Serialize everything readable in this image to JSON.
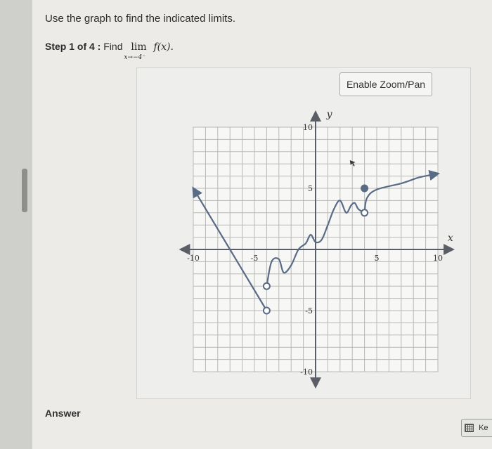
{
  "instruction": "Use the graph to find the indicated limits.",
  "step": {
    "label": "Step 1 of 4 :",
    "find": "Find",
    "lim": "lim",
    "sub": "x→−4⁻",
    "fx": "f(x)."
  },
  "zoom_button": "Enable Zoom/Pan",
  "answer_label": "Answer",
  "keypad_label": "Ke",
  "colors": {
    "curve": "#5a6b86",
    "grid": "#b8b8b4",
    "axis": "#5a5e66"
  },
  "graph": {
    "xlim": [
      -10,
      10
    ],
    "ylim": [
      -10,
      10
    ],
    "axis_labels": {
      "x": "x",
      "y": "y"
    },
    "x_ticks": [
      {
        "value": -10,
        "label": "-10"
      },
      {
        "value": -5,
        "label": "-5"
      },
      {
        "value": 5,
        "label": "5"
      },
      {
        "value": 10,
        "label": "10"
      }
    ],
    "y_ticks": [
      {
        "value": 10,
        "label": "10"
      },
      {
        "value": 5,
        "label": "5"
      },
      {
        "value": -5,
        "label": "-5"
      },
      {
        "value": -10,
        "label": "-10"
      }
    ],
    "segments": [
      {
        "type": "line",
        "points": [
          [
            -10,
            5
          ],
          [
            -4,
            -5
          ]
        ],
        "arrow_start": true
      },
      {
        "type": "curve",
        "points": [
          [
            -4,
            -3
          ],
          [
            -3.6,
            -1
          ],
          [
            -3,
            -0.8
          ],
          [
            -2.6,
            -1.9
          ],
          [
            -2,
            -1.3
          ],
          [
            -1.4,
            0
          ],
          [
            -0.8,
            0.5
          ],
          [
            -0.4,
            1.2
          ],
          [
            0,
            0.6
          ],
          [
            0.5,
            0.8
          ],
          [
            1,
            2
          ],
          [
            1.5,
            3.3
          ],
          [
            2,
            4
          ],
          [
            2.5,
            3
          ],
          [
            2.9,
            3.6
          ],
          [
            3.2,
            3.8
          ],
          [
            3.5,
            3.3
          ],
          [
            4,
            3
          ]
        ]
      },
      {
        "type": "curve",
        "points": [
          [
            4,
            3
          ],
          [
            4.2,
            4.2
          ],
          [
            5,
            4.9
          ],
          [
            7,
            5.4
          ],
          [
            8.5,
            5.9
          ],
          [
            10,
            6.2
          ]
        ],
        "arrow_end": true
      }
    ],
    "open_points": [
      [
        -4,
        -5
      ],
      [
        -4,
        -3
      ],
      [
        4,
        3
      ]
    ],
    "closed_points": [
      [
        4,
        5
      ]
    ]
  }
}
